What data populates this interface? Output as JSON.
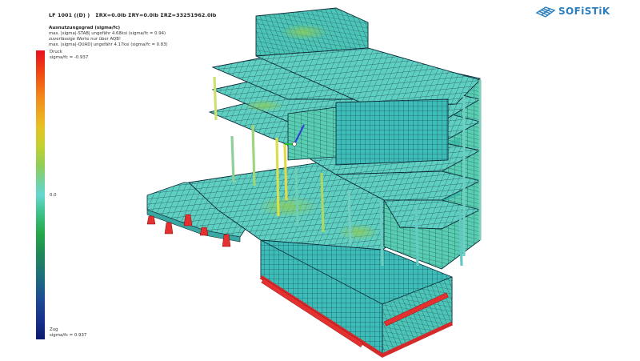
{
  "header": {
    "load_case": "LF 1001 ((D) )",
    "summary": "ΣRX=0.0lb  ΣRY=0.0lb  ΣRZ=33251962.0lb"
  },
  "result_info": {
    "title": "Ausnutzungsgrad (sigma/fc)",
    "lines": [
      "max. |sigma|-STAB| ungefähr 4.68ksi (sigma/fc = 0.94)",
      "zuverlässige Werte nur über AQB!",
      "max. |sigma|-QUAD| ungefähr 4.17ksi (sigma/fc = 0.83)"
    ]
  },
  "legend": {
    "top_label": "Druck",
    "top_value": "sigma/fc = -0.937",
    "mid_value": "0.0",
    "bottom_label": "Zug",
    "bottom_value": "sigma/fc = 0.937"
  },
  "brand": {
    "name": "SOFiSTiK",
    "color": "#2d7fbd"
  },
  "colors": {
    "compression": "#e8101e",
    "neutral": "#67d7d0",
    "tension": "#0c1a6e",
    "supports": "#e53030"
  }
}
